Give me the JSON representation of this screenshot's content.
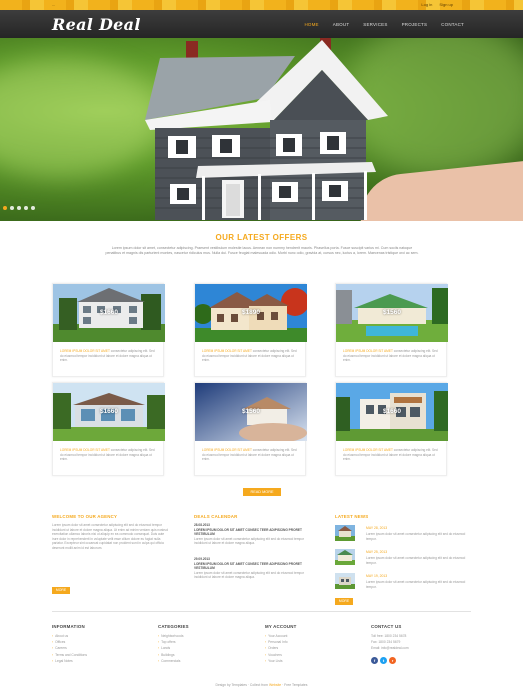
{
  "topbar": {
    "left": "...",
    "right_links": [
      "Log in",
      "Sign up"
    ]
  },
  "brand": {
    "logo": "Real Deal"
  },
  "nav": {
    "items": [
      "HOME",
      "ABOUT",
      "SERVICES",
      "PROJECTS",
      "CONTACT"
    ],
    "active_index": 0
  },
  "slider": {
    "dot_count": 5,
    "active_index": 0
  },
  "offers": {
    "title": "OUR LATEST OFFERS",
    "intro": "Lorem ipsum dolor sit amet, consectetur adipiscing. Praesent vestibulum molestie lacus. Aenean non nummy hendrerit mauris. Phasellus porta. Fusce suscipit varius mi. Cum sociis natoque penatibus et magnis dis parturient montes, nascetur ridiculus mus. Nulla dui. Fusce feugiat malesuada odio. Morbi nunc odio, gravida at, cursus nec, luctus a, lorem. Maecenas tristique orci ac sem.",
    "desc_lead": "LOREM IPSUM DOLOR SIT AMET",
    "desc_body": "consectetur adipiscing elit. Sed do eiusmod tempor incididunt ut labore et dolore magna aliqua ut enim.",
    "cards": [
      {
        "price": "$1660"
      },
      {
        "price": "$1890"
      },
      {
        "price": "$1560"
      },
      {
        "price": "$1660"
      },
      {
        "price": "$1560"
      },
      {
        "price": "$1660"
      }
    ],
    "more_button": "READ MORE"
  },
  "welcome": {
    "title": "WELCOME TO OUR AGENCY",
    "text": "Lorem ipsum dolor sit amet consectetur adipiscing elit sed do eiusmod tempor incididunt ut labore et dolore magna aliqua. Ut enim ad minim veniam quis nostrud exercitation ullamco laboris nisi ut aliquip ex ea commodo consequat. Duis aute irure dolor in reprehenderit in voluptate velit esse cillum dolore eu fugiat nulla pariatur. Excepteur sint occaecat cupidatat non proident sunt in culpa qui officia deserunt mollit anim id est laborum.",
    "button": "MORE"
  },
  "calendar": {
    "title": "DEALS CALENDAR",
    "entries": [
      {
        "date": "28.08.2013",
        "headline": "LOREM IPSUM DOLOR SIT AMET CONSEC TEER ADIPISCING PRORET VESTIBULUM",
        "text": "Lorem ipsum dolor sit amet consectetur adipiscing elit sed do eiusmod tempor incididunt ut labore et dolore magna aliqua."
      },
      {
        "date": "29.09.2013",
        "headline": "LOREM IPSUM DOLOR SIT AMET CONSEC TEER ADIPISCING PRORET VESTIBULUM",
        "text": "Lorem ipsum dolor sit amet consectetur adipiscing elit sed do eiusmod tempor incididunt ut labore et dolore magna aliqua."
      }
    ]
  },
  "news": {
    "title": "LATEST NEWS",
    "items": [
      {
        "date": "MAY 28, 2013",
        "text": "Lorem ipsum dolor sit amet consectetur adipiscing elit sed do eiusmod tempor."
      },
      {
        "date": "MAY 25, 2013",
        "text": "Lorem ipsum dolor sit amet consectetur adipiscing elit sed do eiusmod tempor."
      },
      {
        "date": "MAY 19, 2013",
        "text": "Lorem ipsum dolor sit amet consectetur adipiscing elit sed do eiusmod tempor."
      }
    ],
    "button": "MORE"
  },
  "footer": {
    "information": {
      "title": "INFORMATION",
      "links": [
        "About us",
        "Offices",
        "Careers",
        "Terms and Conditions",
        "Legal Notes"
      ]
    },
    "categories": {
      "title": "CATEGORIES",
      "links": [
        "Neighborhoods",
        "Top offers",
        "Lands",
        "Buildings",
        "Commercials"
      ]
    },
    "account": {
      "title": "MY ACCOUNT",
      "links": [
        "Your Account",
        "Personal Info",
        "Orders",
        "Vouchers",
        "Your Lists"
      ]
    },
    "contact": {
      "title": "CONTACT US",
      "lines": [
        "Toll free: 1800 234 5678",
        "Fax: 1800 234 5679",
        "Email: info@realdeal.com"
      ]
    },
    "social_icons": [
      "facebook-icon",
      "twitter-icon",
      "rss-icon"
    ],
    "copyright_pre": "Design by Templates · Collect from",
    "copyright_link": "Website",
    "copyright_post": "· Free Templates"
  },
  "colors": {
    "accent": "#f5a91e",
    "header": "#2b2b2b",
    "facebook": "#3b5998",
    "twitter": "#1da1f2",
    "rss": "#f26522"
  }
}
